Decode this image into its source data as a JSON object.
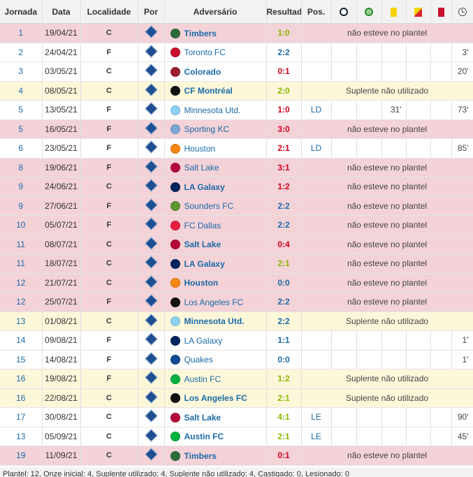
{
  "table": {
    "headers": {
      "round": "Jornada",
      "date": "Data",
      "venue": "Localidade",
      "by": "Por",
      "opponent": "Adversário",
      "result": "Resultado",
      "position": "Pos."
    },
    "header_icons": [
      "goal-ball-icon",
      "assist-ball-icon",
      "yellow-card-icon",
      "second-yellow-card-icon",
      "red-card-icon",
      "clock-icon"
    ],
    "rows": [
      {
        "round": "1",
        "date": "19/04/21",
        "venue": "C",
        "opponent": "Timbers",
        "crest": "#2e6b3b",
        "result": "1:0",
        "result_color": "#8ab800",
        "type": "absent",
        "status": "não esteve no plantel"
      },
      {
        "round": "2",
        "date": "24/04/21",
        "venue": "F",
        "opponent": "Toronto FC",
        "crest": "#c8102e",
        "result": "2:2",
        "result_color": "#1a6aa7",
        "type": "played",
        "pos": "",
        "goal": "",
        "yellow": "",
        "min": "3'"
      },
      {
        "round": "3",
        "date": "03/05/21",
        "venue": "C",
        "opponent": "Colorado",
        "crest": "#9e1b32",
        "result": "0:1",
        "result_color": "#d0021b",
        "type": "played",
        "pos": "",
        "goal": "",
        "yellow": "",
        "min": "20'"
      },
      {
        "round": "4",
        "date": "08/05/21",
        "venue": "C",
        "opponent": "CF Montréal",
        "crest": "#111111",
        "result": "2:0",
        "result_color": "#8ab800",
        "type": "bench",
        "status": "Suplente não utilizado"
      },
      {
        "round": "5",
        "date": "13/05/21",
        "venue": "F",
        "opponent": "Minnesota Utd.",
        "crest": "#8cd2f4",
        "result": "1:0",
        "result_color": "#d0021b",
        "type": "played",
        "pos": "LD",
        "goal": "",
        "yellow": "31'",
        "min": "73'"
      },
      {
        "round": "5",
        "date": "16/05/21",
        "venue": "F",
        "opponent": "Sporting KC",
        "crest": "#7ea6d3",
        "result": "3:0",
        "result_color": "#d0021b",
        "type": "absent",
        "status": "não esteve no plantel"
      },
      {
        "round": "6",
        "date": "23/05/21",
        "venue": "F",
        "opponent": "Houston",
        "crest": "#f68712",
        "result": "2:1",
        "result_color": "#d0021b",
        "type": "played",
        "pos": "LD",
        "goal": "",
        "yellow": "",
        "min": "85'"
      },
      {
        "round": "8",
        "date": "19/06/21",
        "venue": "F",
        "opponent": "Salt Lake",
        "crest": "#b30838",
        "result": "3:1",
        "result_color": "#d0021b",
        "type": "absent",
        "status": "não esteve no plantel"
      },
      {
        "round": "9",
        "date": "24/06/21",
        "venue": "C",
        "opponent": "LA Galaxy",
        "crest": "#00245d",
        "result": "1:2",
        "result_color": "#d0021b",
        "type": "absent",
        "status": "não esteve no plantel"
      },
      {
        "round": "9",
        "date": "27/06/21",
        "venue": "F",
        "opponent": "Sounders FC",
        "crest": "#5d9732",
        "result": "2:2",
        "result_color": "#1a6aa7",
        "type": "absent",
        "status": "não esteve no plantel"
      },
      {
        "round": "10",
        "date": "05/07/21",
        "venue": "F",
        "opponent": "FC Dallas",
        "crest": "#e81f3e",
        "result": "2:2",
        "result_color": "#1a6aa7",
        "type": "absent",
        "status": "não esteve no plantel"
      },
      {
        "round": "11",
        "date": "08/07/21",
        "venue": "C",
        "opponent": "Salt Lake",
        "crest": "#b30838",
        "result": "0:4",
        "result_color": "#d0021b",
        "type": "absent",
        "status": "não esteve no plantel"
      },
      {
        "round": "11",
        "date": "18/07/21",
        "venue": "C",
        "opponent": "LA Galaxy",
        "crest": "#00245d",
        "result": "2:1",
        "result_color": "#8ab800",
        "type": "absent",
        "status": "não esteve no plantel"
      },
      {
        "round": "12",
        "date": "21/07/21",
        "venue": "C",
        "opponent": "Houston",
        "crest": "#f68712",
        "result": "0:0",
        "result_color": "#1a6aa7",
        "type": "absent",
        "status": "não esteve no plantel"
      },
      {
        "round": "12",
        "date": "25/07/21",
        "venue": "F",
        "opponent": "Los Angeles FC",
        "crest": "#111111",
        "result": "2:2",
        "result_color": "#1a6aa7",
        "type": "absent",
        "status": "não esteve no plantel"
      },
      {
        "round": "13",
        "date": "01/08/21",
        "venue": "C",
        "opponent": "Minnesota Utd.",
        "crest": "#8cd2f4",
        "result": "2:2",
        "result_color": "#1a6aa7",
        "type": "bench",
        "status": "Suplente não utilizado"
      },
      {
        "round": "14",
        "date": "09/08/21",
        "venue": "F",
        "opponent": "LA Galaxy",
        "crest": "#00245d",
        "result": "1:1",
        "result_color": "#1a6aa7",
        "type": "played",
        "pos": "",
        "goal": "",
        "yellow": "",
        "min": "1'"
      },
      {
        "round": "15",
        "date": "14/08/21",
        "venue": "F",
        "opponent": "Quakes",
        "crest": "#0d4c92",
        "result": "0:0",
        "result_color": "#1a6aa7",
        "type": "played",
        "pos": "",
        "goal": "",
        "yellow": "",
        "min": "1'"
      },
      {
        "round": "16",
        "date": "19/08/21",
        "venue": "F",
        "opponent": "Austin FC",
        "crest": "#00b140",
        "result": "1:2",
        "result_color": "#8ab800",
        "type": "bench",
        "status": "Suplente não utilizado"
      },
      {
        "round": "16",
        "date": "22/08/21",
        "venue": "C",
        "opponent": "Los Angeles FC",
        "crest": "#111111",
        "result": "2:1",
        "result_color": "#8ab800",
        "type": "bench",
        "status": "Suplente não utilizado"
      },
      {
        "round": "17",
        "date": "30/08/21",
        "venue": "C",
        "opponent": "Salt Lake",
        "crest": "#b30838",
        "result": "4:1",
        "result_color": "#8ab800",
        "type": "played",
        "pos": "LE",
        "goal": "",
        "yellow": "",
        "min": "90'"
      },
      {
        "round": "13",
        "date": "05/09/21",
        "venue": "C",
        "opponent": "Austin FC",
        "crest": "#00b140",
        "result": "2:1",
        "result_color": "#8ab800",
        "type": "played",
        "pos": "LE",
        "goal": "",
        "yellow": "",
        "min": "45'"
      },
      {
        "round": "19",
        "date": "11/09/21",
        "venue": "C",
        "opponent": "Timbers",
        "crest": "#2e6b3b",
        "result": "0:1",
        "result_color": "#d0021b",
        "type": "absent",
        "status": "não esteve no plantel"
      }
    ]
  },
  "footer": {
    "summary": "Plantel: 12, Onze inicial: 4, Suplente utilizado: 4, Suplente não utilizado: 4, Castigado: 0, Lesionado: 0"
  }
}
